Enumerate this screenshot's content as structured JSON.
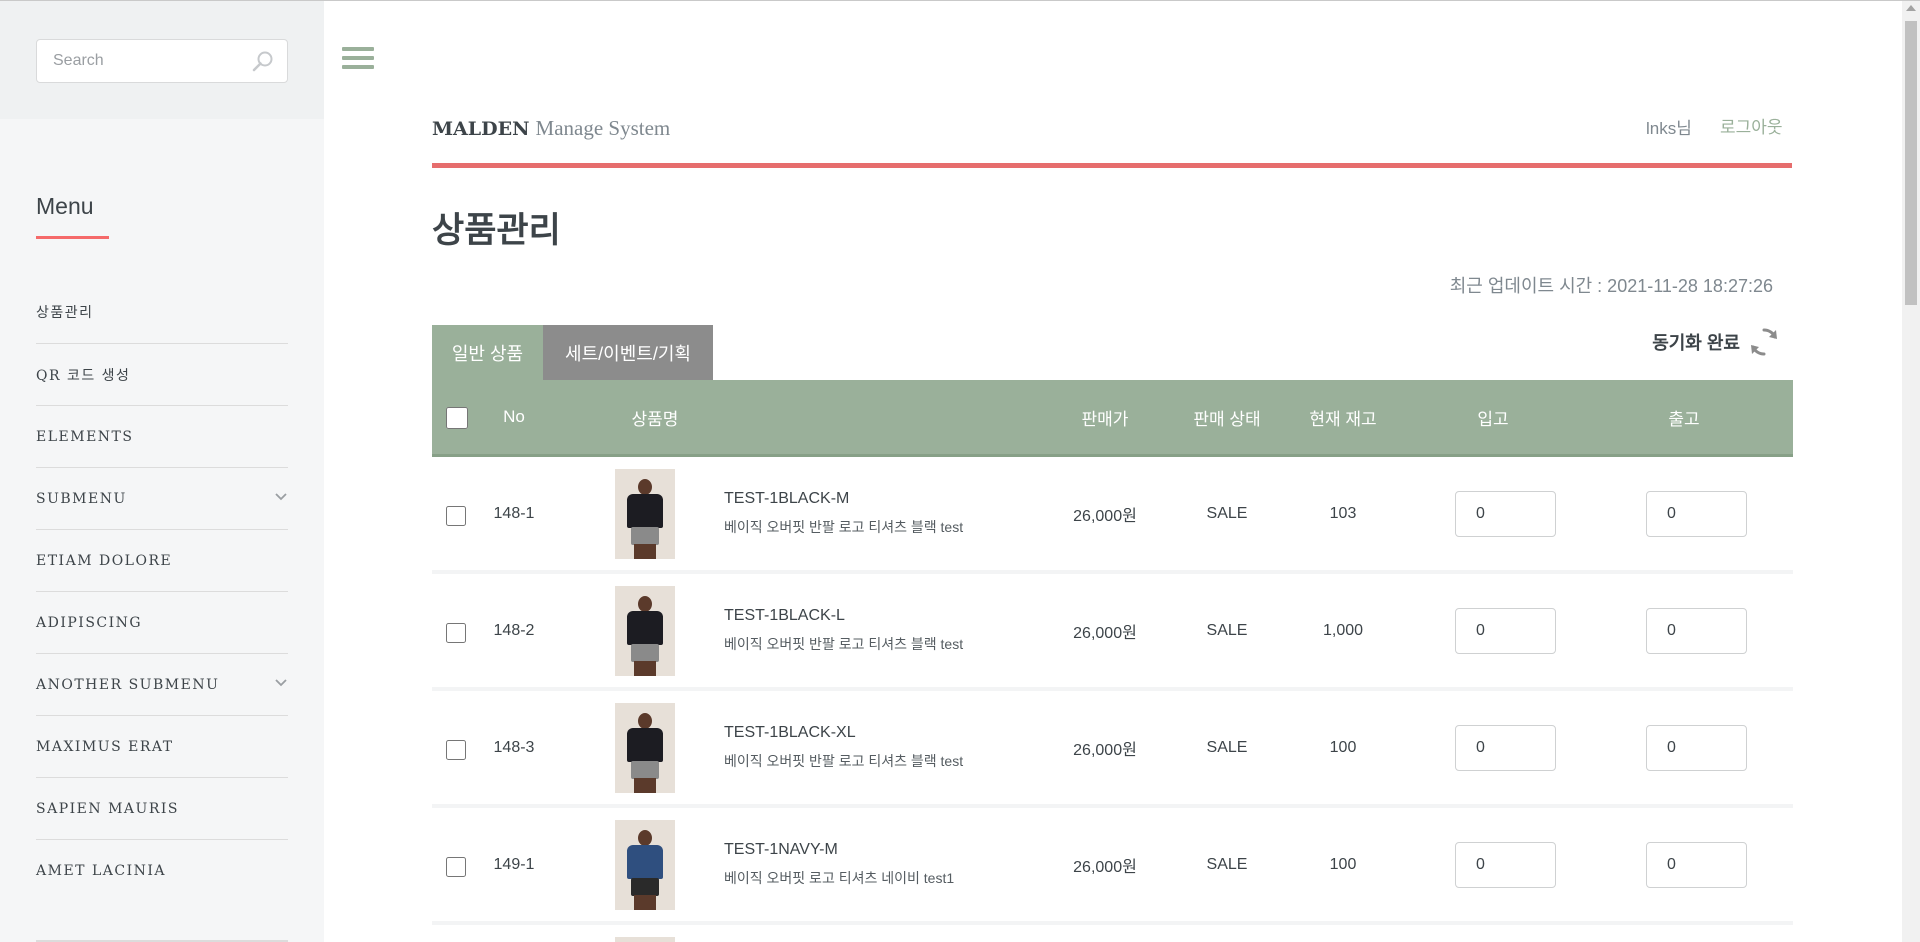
{
  "sidebar": {
    "search": {
      "placeholder": "Search",
      "value": ""
    },
    "menu_heading": "Menu",
    "items": [
      {
        "label": "상품관리",
        "has_submenu": false
      },
      {
        "label": "QR 코드 생성",
        "has_submenu": false
      },
      {
        "label": "ELEMENTS",
        "has_submenu": false
      },
      {
        "label": "SUBMENU",
        "has_submenu": true
      },
      {
        "label": "ETIAM DOLORE",
        "has_submenu": false
      },
      {
        "label": "ADIPISCING",
        "has_submenu": false
      },
      {
        "label": "ANOTHER SUBMENU",
        "has_submenu": true
      },
      {
        "label": "MAXIMUS ERAT",
        "has_submenu": false
      },
      {
        "label": "SAPIEN MAURIS",
        "has_submenu": false
      },
      {
        "label": "AMET LACINIA",
        "has_submenu": false
      }
    ]
  },
  "header": {
    "brand_bold": "MALDEN",
    "brand_rest": "Manage System",
    "user": "lnks님",
    "logout": "로그아웃"
  },
  "main": {
    "page_title": "상품관리",
    "update_time": "최근 업데이트 시간 : 2021-11-28 18:27:26",
    "tabs": [
      {
        "label": "일반 상품",
        "active": true
      },
      {
        "label": "세트/이벤트/기획",
        "active": false
      }
    ],
    "sync_label": "동기화 완료",
    "table": {
      "headers": [
        "No",
        "상품명",
        "판매가",
        "판매 상태",
        "현재 재고",
        "입고",
        "출고"
      ],
      "rows": [
        {
          "no": "148-1",
          "name": "TEST-1BLACK-M",
          "desc": "베이직 오버핏 반팔 로고 티셔츠 블랙 test",
          "price": "26,000원",
          "status": "SALE",
          "stock": "103",
          "in": "0",
          "out": "0",
          "shirt": "black"
        },
        {
          "no": "148-2",
          "name": "TEST-1BLACK-L",
          "desc": "베이직 오버핏 반팔 로고 티셔츠 블랙 test",
          "price": "26,000원",
          "status": "SALE",
          "stock": "1,000",
          "in": "0",
          "out": "0",
          "shirt": "black"
        },
        {
          "no": "148-3",
          "name": "TEST-1BLACK-XL",
          "desc": "베이직 오버핏 반팔 로고 티셔츠 블랙 test",
          "price": "26,000원",
          "status": "SALE",
          "stock": "100",
          "in": "0",
          "out": "0",
          "shirt": "black"
        },
        {
          "no": "149-1",
          "name": "TEST-1NAVY-M",
          "desc": "베이직 오버핏 로고 티셔츠 네이비 test1",
          "price": "26,000원",
          "status": "SALE",
          "stock": "100",
          "in": "0",
          "out": "0",
          "shirt": "navy"
        }
      ]
    }
  },
  "colors": {
    "accent_green": "#9ab09a",
    "accent_red": "#f56a6a",
    "tab_inactive": "#8c8c8c",
    "text": "#3d4449"
  },
  "icons": {
    "search": "search-icon",
    "chevron": "chevron-down-icon",
    "sync": "refresh-icon",
    "hamburger": "hamburger-menu-icon"
  }
}
